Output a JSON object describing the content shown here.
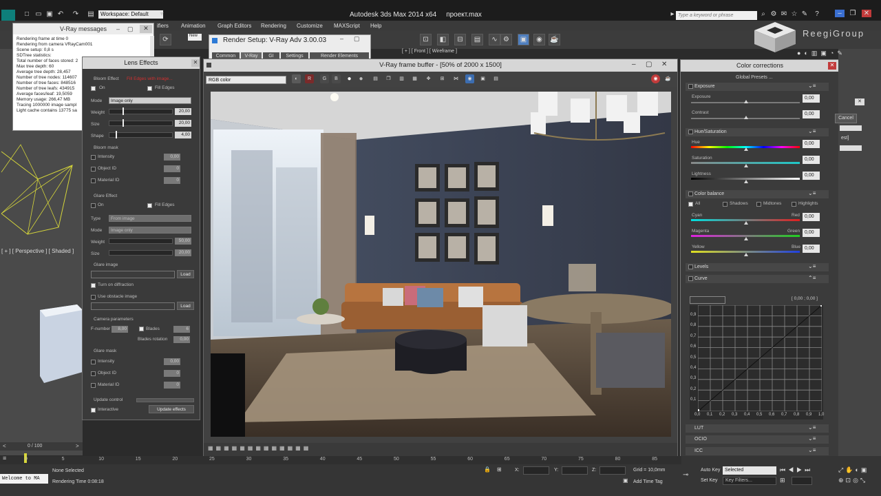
{
  "app": {
    "title": "Autodesk 3ds Max  2014 x64",
    "file": "проект.max",
    "workspace": "Workspace: Default",
    "search_placeholder": "Type a keyword or phrase"
  },
  "menu": [
    "ifiers",
    "Animation",
    "Graph Editors",
    "Rendering",
    "Customize",
    "MAXScript",
    "Help"
  ],
  "brand": "ReegiGroup",
  "viewports": {
    "front": "[ + ] [ Front ] [ Wireframe ]",
    "perspective": "[ + ] [ Perspective ] [ Shaded ]"
  },
  "vray_messages": {
    "title": "V-Ray messages",
    "lines": [
      "Rendering frame at time 0",
      "Rendering from camera VRayCam001",
      "Scene setup: 0,8 s",
      "SDTree statistics:",
      "Total number of faces stored: 2",
      "Max tree depth: 60",
      "Average tree depth: 28,457",
      "Number of tree nodes: 114607",
      "Number of tree faces: 848516",
      "Number of tree leafs: 434915",
      "Average faces/leaf: 19,5059",
      "Memory usage: 266,47 MB",
      "Tracing 1000000 image sampl",
      "Light cache contains 13775 sa"
    ]
  },
  "lens_effects": {
    "title": "Lens Effects",
    "bloom_effect": "Bloom Effect",
    "bloom_note": "Fill Edges with image...",
    "on": "On",
    "fill_edges": "Fill Edges",
    "mode": "Mode",
    "mode_value": "Image only",
    "weight": "Weight",
    "weight_value": "20,00",
    "size": "Size",
    "size_value": "20,00",
    "shape": "Shape",
    "shape_value": "4,00",
    "bloom_mask": "Bloom mask",
    "intensity": "Intensity",
    "intensity_value": "0,00",
    "object_id": "Object ID",
    "object_id_value": "0",
    "material_id": "Material ID",
    "material_id_value": "0",
    "glare_effect": "Glare Effect",
    "type": "Type",
    "type_value": "From image",
    "glare_mode_value": "Image only",
    "glare_weight_value": "50,00",
    "glare_size_value": "20,00",
    "glare_image": "Glare image",
    "load": "Load",
    "turn_on_diffraction": "Turn on diffraction",
    "use_obstacle_image": "Use obstacle image",
    "camera_parameters": "Camera parameters",
    "fnumber": "F-number",
    "fnumber_value": "8,00",
    "blades": "Blades",
    "blades_value": "6",
    "blades_rotation": "Blades rotation",
    "blades_rotation_value": "0,00",
    "glare_mask": "Glare mask",
    "update_control": "Update control",
    "interactive": "Interactive",
    "update_effects": "Update effects"
  },
  "render_setup": {
    "title": "Render Setup: V-Ray Adv 3.00.03",
    "view": "New",
    "tabs": [
      "Common",
      "V-Ray",
      "GI",
      "Settings",
      "Render Elements"
    ]
  },
  "frame_buffer": {
    "title": "V-Ray frame buffer - [50% of 2000 x 1500]",
    "channel": "RGB color",
    "channel_buttons": [
      "R",
      "G",
      "B"
    ]
  },
  "color_corrections": {
    "title": "Color corrections",
    "global_presets": "Global Presets ...",
    "exposure": {
      "label": "Exposure",
      "exposure": "Exposure",
      "exposure_value": "0,00",
      "contrast": "Contrast",
      "contrast_value": "0,00"
    },
    "hue": {
      "label": "Hue/Saturation",
      "hue": "Hue",
      "hue_value": "0,00",
      "saturation": "Saturation",
      "saturation_value": "0,00",
      "lightness": "Lightness",
      "lightness_value": "0,00"
    },
    "balance": {
      "label": "Color balance",
      "all": "All",
      "shadows": "Shadows",
      "midtones": "Midtones",
      "highlights": "Highlights",
      "cyan": "Cyan",
      "red": "Red",
      "cyan_value": "0,00",
      "magenta": "Magenta",
      "green": "Green",
      "magenta_value": "0,00",
      "yellow": "Yellow",
      "blue": "Blue",
      "yellow_value": "0,00"
    },
    "levels": "Levels",
    "curve": {
      "label": "Curve",
      "readout": "[ 0,00 ; 0,00 ]",
      "y_ticks": [
        "0,9",
        "0,8",
        "0,7",
        "0,6",
        "0,5",
        "0,4",
        "0,3",
        "0,2",
        "0,1"
      ],
      "x_ticks": [
        "0,0",
        "0,1",
        "0,2",
        "0,3",
        "0,4",
        "0,5",
        "0,6",
        "0,7",
        "0,8",
        "0,9",
        "1,0"
      ]
    },
    "lut": "LUT",
    "ocio": "OCIO",
    "icc": "ICC"
  },
  "timeline": {
    "frame": "0 / 100",
    "ticks": [
      "0",
      "5",
      "10",
      "15",
      "20",
      "25",
      "30",
      "35",
      "40",
      "45",
      "50",
      "55",
      "60",
      "65",
      "70",
      "75",
      "80",
      "85"
    ]
  },
  "status": {
    "welcome": "Welcome to MA",
    "none_selected": "None Selected",
    "rendering_time": "Rendering Time  0:08:18",
    "x_label": "X:",
    "y_label": "Y:",
    "z_label": "Z:",
    "grid": "Grid = 10,0mm",
    "add_time_tag": "Add Time Tag",
    "auto_key": "Auto Key",
    "set_key": "Set Key",
    "selected": "Selected",
    "key_filters": "Key Filters..."
  },
  "side_dialog": {
    "cancel": "Cancel",
    "est": "est]"
  }
}
